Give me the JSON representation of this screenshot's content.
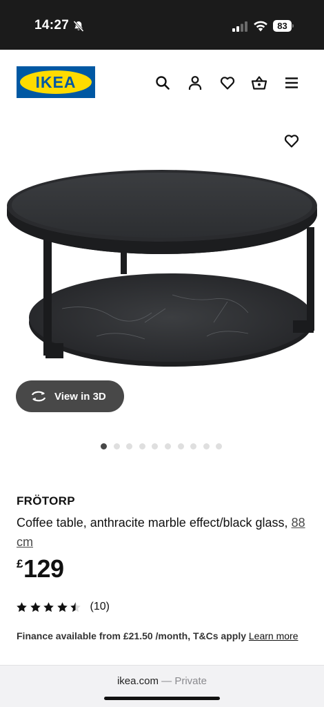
{
  "status_bar": {
    "time": "14:27",
    "battery": "83",
    "icons": [
      "bell-slash-icon",
      "signal-icon",
      "wifi-icon",
      "battery-icon"
    ]
  },
  "header": {
    "logo_text": "IKEA",
    "icons": [
      "search-icon",
      "account-icon",
      "wishlist-heart-icon",
      "shopping-bag-icon",
      "menu-icon"
    ]
  },
  "product": {
    "view3d_label": "View in 3D",
    "image_count": 10,
    "active_image_index": 0,
    "name": "FRÖTORP",
    "description": "Coffee table, anthracite marble effect/black glass, ",
    "size_link": "88 cm",
    "price_currency": "£",
    "price_value": "129",
    "rating": 4.5,
    "rating_max": 5,
    "review_count": "(10)",
    "finance_text": "Finance available from £21.50 /month, T&Cs apply ",
    "finance_link": "Learn more"
  },
  "browser": {
    "domain": "ikea.com",
    "separator": " — ",
    "mode": "Private"
  },
  "colors": {
    "ikea_blue": "#0058a3",
    "ikea_yellow": "#ffdb00",
    "button_dark": "#484848",
    "status_bar_bg": "#1b1b1b"
  }
}
